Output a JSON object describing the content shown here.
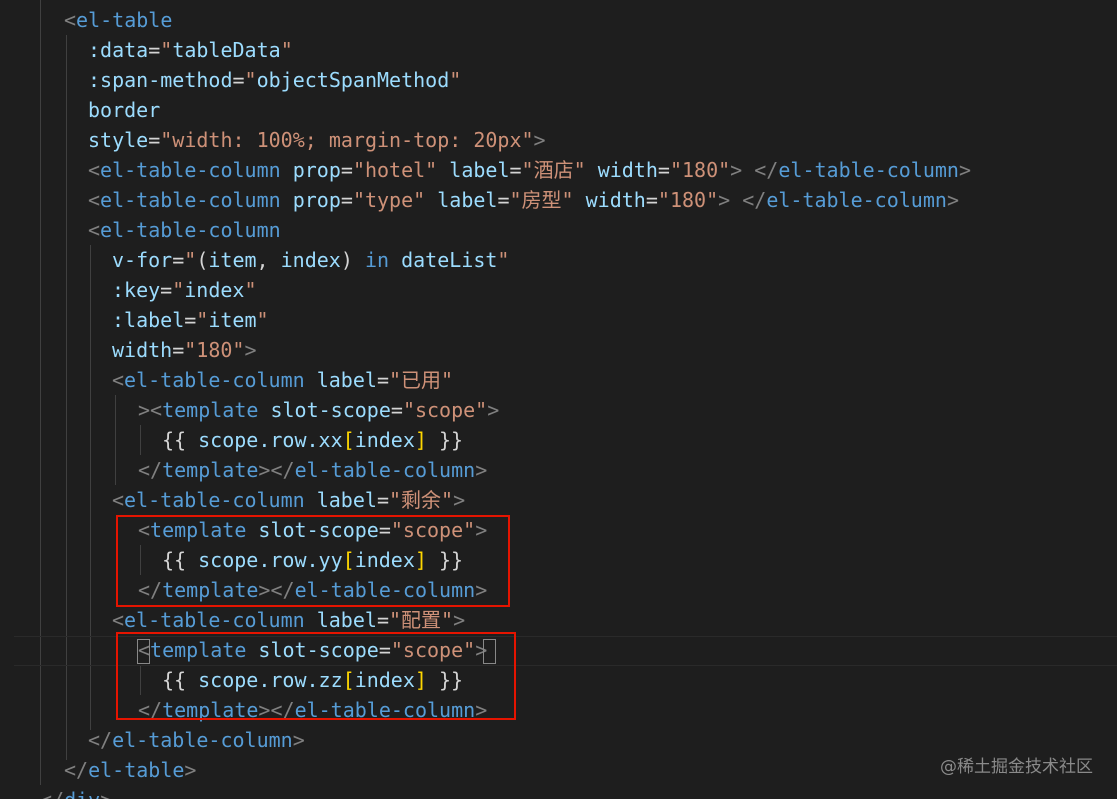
{
  "code_lines": [
    "<el-table",
    ":data=\"tableData\"",
    ":span-method=\"objectSpanMethod\"",
    "border",
    "style=\"width: 100%; margin-top: 20px\">",
    "<el-table-column prop=\"hotel\" label=\"酒店\" width=\"180\"> </el-table-column>",
    "<el-table-column prop=\"type\" label=\"房型\" width=\"180\"> </el-table-column>",
    "<el-table-column",
    "v-for=\"(item, index) in dateList\"",
    ":key=\"index\"",
    ":label=\"item\"",
    "width=\"180\">",
    "<el-table-column label=\"已用\"",
    "><template slot-scope=\"scope\">",
    "{{ scope.row.xx[index] }}",
    "</template></el-table-column>",
    "<el-table-column label=\"剩余\">",
    "<template slot-scope=\"scope\">",
    "{{ scope.row.yy[index] }}",
    "</template></el-table-column>",
    "<el-table-column label=\"配置\">",
    "<template slot-scope=\"scope\">",
    "{{ scope.row.zz[index] }}",
    "</template></el-table-column>",
    "</el-table-column>",
    "</el-table>",
    "</div>"
  ],
  "watermark": "@稀土掘金技术社区",
  "colors": {
    "background": "#1e1e1e",
    "tag": "#569cd6",
    "attribute": "#9cdcfe",
    "string": "#ce9178",
    "punctuation": "#808080",
    "text": "#d4d4d4",
    "highlight_box": "#e51400"
  }
}
